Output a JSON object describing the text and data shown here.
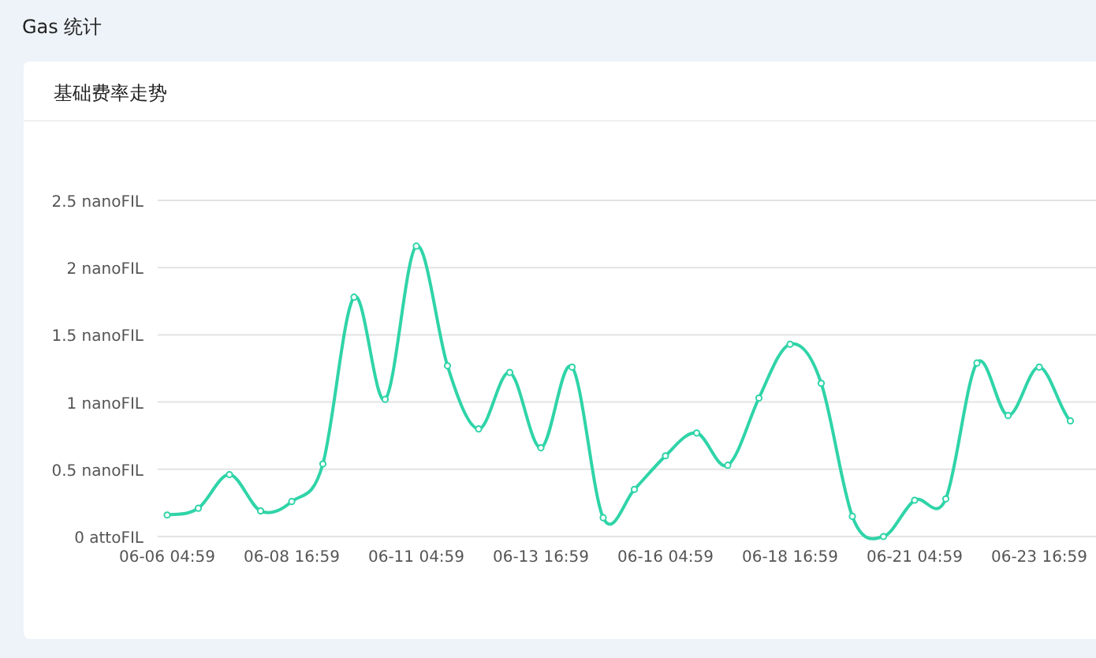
{
  "page_title": "Gas 统计",
  "card": {
    "title": "基础费率走势",
    "chart_data": {
      "type": "line",
      "categories": [
        "06-06 04:59",
        null,
        null,
        null,
        "06-08 16:59",
        null,
        null,
        null,
        "06-11 04:59",
        null,
        null,
        null,
        "06-13 16:59",
        null,
        null,
        null,
        "06-16 04:59",
        null,
        null,
        null,
        "06-18 16:59",
        null,
        null,
        null,
        "06-21 04:59",
        null,
        null,
        null,
        "06-23 16:59",
        null,
        null
      ],
      "grid": true,
      "series": [
        {
          "color": "#2fd4a8",
          "marker": true,
          "values": [
            0.16,
            0.21,
            0.46,
            0.19,
            0.26,
            0.54,
            1.78,
            1.02,
            2.16,
            1.27,
            0.8,
            1.22,
            0.66,
            1.26,
            0.14,
            0.35,
            0.6,
            0.77,
            0.53,
            1.03,
            1.43,
            1.14,
            0.15,
            0.0,
            0.27,
            0.28,
            1.29,
            0.9,
            1.26,
            0.86,
            null
          ]
        }
      ],
      "ylim": [
        0,
        2.5
      ],
      "yticks": [
        {
          "value": 0,
          "label": "0 attoFIL"
        },
        {
          "value": 0.5,
          "label": "0.5 nanoFIL"
        },
        {
          "value": 1,
          "label": "1 nanoFIL"
        },
        {
          "value": 1.5,
          "label": "1.5 nanoFIL"
        },
        {
          "value": 2,
          "label": "2 nanoFIL"
        },
        {
          "value": 2.5,
          "label": "2.5 nanoFIL"
        }
      ]
    }
  }
}
